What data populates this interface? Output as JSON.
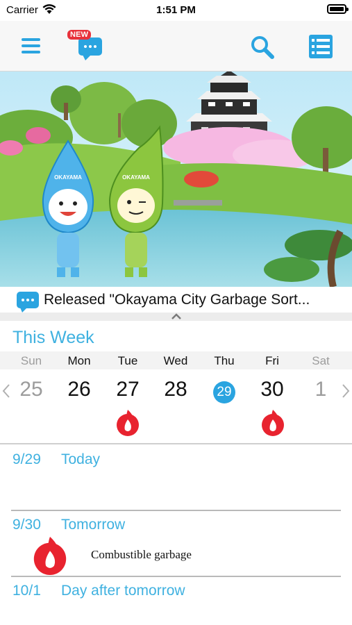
{
  "status_bar": {
    "carrier": "Carrier",
    "time": "1:51 PM"
  },
  "nav": {
    "new_badge": "NEW",
    "icons": [
      "hamburger-menu-icon",
      "speech-bubble-icon",
      "search-icon",
      "list-icon"
    ]
  },
  "hero": {
    "mascot_left_text": "OKAYAMA",
    "mascot_right_text": "OKAYAMA"
  },
  "news": {
    "text": "Released \"Okayama City Garbage Sort..."
  },
  "week": {
    "title": "This Week",
    "days": [
      "Sun",
      "Mon",
      "Tue",
      "Wed",
      "Thu",
      "Fri",
      "Sat"
    ],
    "dates": [
      "25",
      "26",
      "27",
      "28",
      "29",
      "30",
      "1"
    ],
    "today_index": 4,
    "garbage_days": [
      "Tue",
      "Fri"
    ]
  },
  "schedule": [
    {
      "date": "9/29",
      "label": "Today",
      "items": []
    },
    {
      "date": "9/30",
      "label": "Tomorrow",
      "items": [
        {
          "icon": "flame-icon",
          "text": "Combustible garbage"
        }
      ]
    },
    {
      "date": "10/1",
      "label": "Day after tomorrow",
      "items": []
    }
  ],
  "colors": {
    "accent": "#2aa4e0",
    "title_blue": "#3fb1e0",
    "flame_red": "#e8232f",
    "new_red": "#e8323b"
  }
}
